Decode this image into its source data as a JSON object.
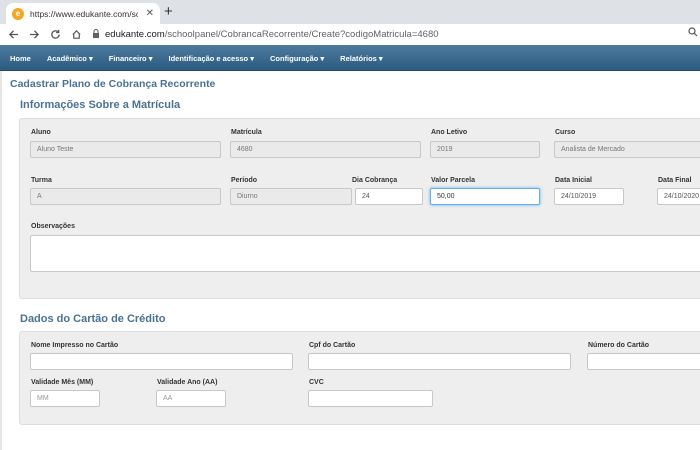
{
  "browser": {
    "tab_title": "https://www.edukante.com/schoo",
    "tab_close": "✕",
    "new_tab": "+",
    "url_host": "edukante.com",
    "url_path": "/schoolpanel/CobrancaRecorrente/Create?codigoMatricula=4680"
  },
  "navbar": {
    "items": [
      "Home",
      "Acadêmico ▾",
      "Financeiro ▾",
      "Identificação e acesso ▾",
      "Configuração ▾",
      "Relatórios ▾"
    ]
  },
  "page": {
    "title": "Cadastrar Plano de Cobrança Recorrente"
  },
  "matricula": {
    "section_title": "Informações Sobre a Matrícula",
    "aluno_label": "Aluno",
    "aluno_value": "Aluno Teste",
    "matricula_label": "Matrícula",
    "matricula_value": "4680",
    "ano_label": "Ano Letivo",
    "ano_value": "2019",
    "curso_label": "Curso",
    "curso_value": "Analista de Mercado",
    "turma_label": "Turma",
    "turma_value": "A",
    "periodo_label": "Período",
    "periodo_value": "Diurno",
    "dia_label": "Dia Cobrança",
    "dia_value": "24",
    "valor_label": "Valor Parcela",
    "valor_value": "50,00",
    "data_inicial_label": "Data Inicial",
    "data_inicial_value": "24/10/2019",
    "data_final_label": "Data Final",
    "data_final_value": "24/10/2020",
    "obs_label": "Observações"
  },
  "cartao": {
    "section_title": "Dados do Cartão de Crédito",
    "nome_label": "Nome Impresso no Cartão",
    "cpf_label": "Cpf do Cartão",
    "numero_label": "Número do Cartão",
    "mes_label": "Validade Mês (MM)",
    "mes_placeholder": "MM",
    "ano_label": "Validade Ano (AA)",
    "ano_placeholder": "AA",
    "cvc_label": "CVC"
  }
}
